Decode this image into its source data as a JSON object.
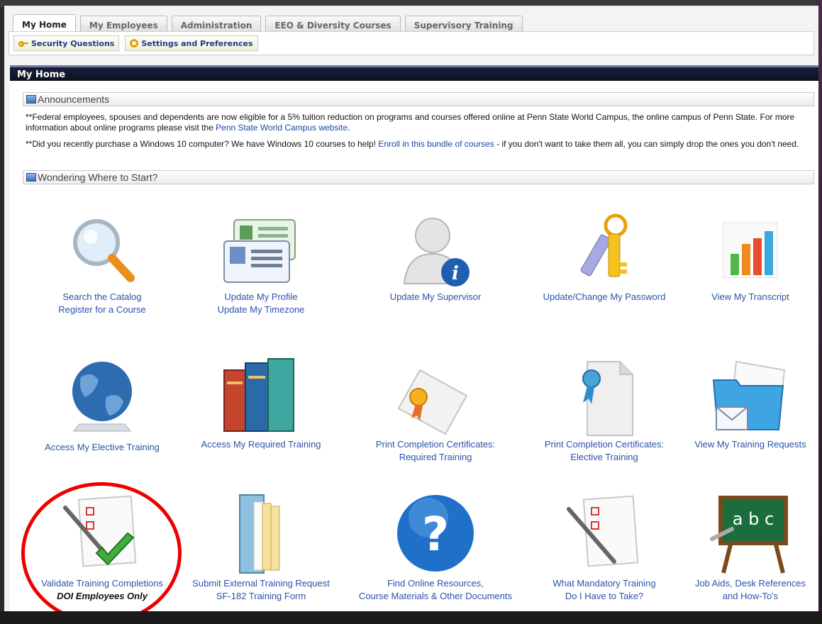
{
  "tabs": [
    {
      "label": "My Home",
      "active": true
    },
    {
      "label": "My Employees",
      "active": false
    },
    {
      "label": "Administration",
      "active": false
    },
    {
      "label": "EEO & Diversity Courses",
      "active": false
    },
    {
      "label": "Supervisory Training",
      "active": false
    }
  ],
  "subnav": {
    "security_questions": "Security Questions",
    "settings": "Settings and Preferences"
  },
  "header": {
    "title": "My Home"
  },
  "announcements": {
    "title": "Announcements",
    "item1_pre": "**Federal employees, spouses and dependents are now eligible for a 5% tuition reduction on programs and courses offered online at Penn State World Campus, the online campus of Penn State. For more information about online programs please visit the ",
    "item1_link": "Penn State World Campus website",
    "item1_post": ".",
    "item2_pre": "**Did you recently purchase a Windows 10 computer? We have Windows 10 courses to help! ",
    "item2_link": "Enroll in this bundle of courses",
    "item2_post": " - if you don't want to take them all, you can simply drop the ones you don't need."
  },
  "start": {
    "title": "Wondering Where to Start?"
  },
  "tiles": {
    "search": {
      "line1": "Search the Catalog",
      "line2": "Register for a Course"
    },
    "profile": {
      "line1": "Update My Profile",
      "line2": "Update My Timezone"
    },
    "supervisor": {
      "line1": "Update My Supervisor"
    },
    "password": {
      "line1": "Update/Change My Password"
    },
    "transcript": {
      "line1": "View My Transcript"
    },
    "elective": {
      "line1": "Access My Elective Training"
    },
    "required": {
      "line1": "Access My Required Training"
    },
    "cert_required": {
      "line1": "Print Completion Certificates:",
      "line2": "Required Training"
    },
    "cert_elective": {
      "line1": "Print Completion Certificates:",
      "line2": "Elective Training"
    },
    "requests": {
      "line1": "View My Training Requests"
    },
    "validate": {
      "line1": "Validate Training Completions",
      "note": "DOI Employees Only"
    },
    "external": {
      "line1": "Submit External Training Request",
      "line2": "SF-182 Training Form"
    },
    "resources": {
      "line1": "Find Online Resources,",
      "line2": "Course Materials & Other Documents"
    },
    "mandatory": {
      "line1": "What Mandatory Training",
      "line2": "Do I Have to Take?"
    },
    "jobaids": {
      "line1": "Job Aids, Desk References",
      "line2": "and How-To's"
    }
  },
  "icons": {
    "search": "magnifier-icon",
    "profile": "id-cards-icon",
    "supervisor": "user-info-icon",
    "password": "keys-icon",
    "transcript": "bar-chart-icon",
    "elective": "globe-icon",
    "required": "books-icon",
    "cert_required": "certificate-icon",
    "cert_elective": "certificate-page-icon",
    "requests": "folder-mail-icon",
    "validate": "checklist-check-icon",
    "external": "folder-papers-icon",
    "resources": "question-icon",
    "mandatory": "checklist-pen-icon",
    "jobaids": "chalkboard-icon"
  },
  "colors": {
    "link": "#2b52a8",
    "header": "#0d1020",
    "highlight": "#e00000"
  }
}
